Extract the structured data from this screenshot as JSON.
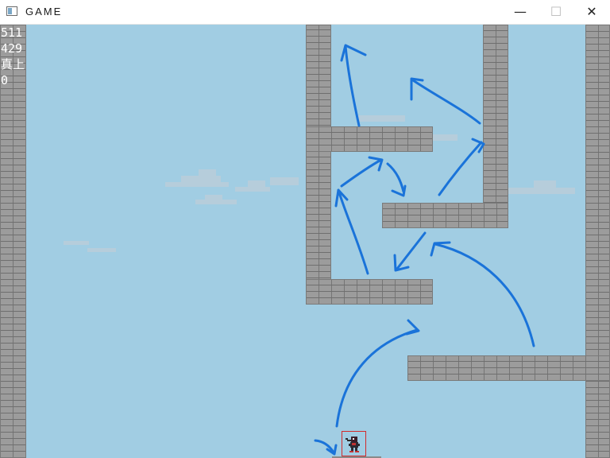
{
  "window": {
    "title": "GAME",
    "controls": {
      "minimize": "—",
      "maximize": "☐",
      "close": "✕"
    }
  },
  "hud": {
    "lines": [
      "511",
      "429",
      "真上",
      "0"
    ]
  },
  "colors": {
    "sky": "#a1cde3",
    "brick": "#9c9c9c",
    "arrow": "#1a73d9",
    "player_box": "#d22b2b"
  },
  "icons": {
    "app": "window-icon",
    "player": "ninja-sprite"
  }
}
